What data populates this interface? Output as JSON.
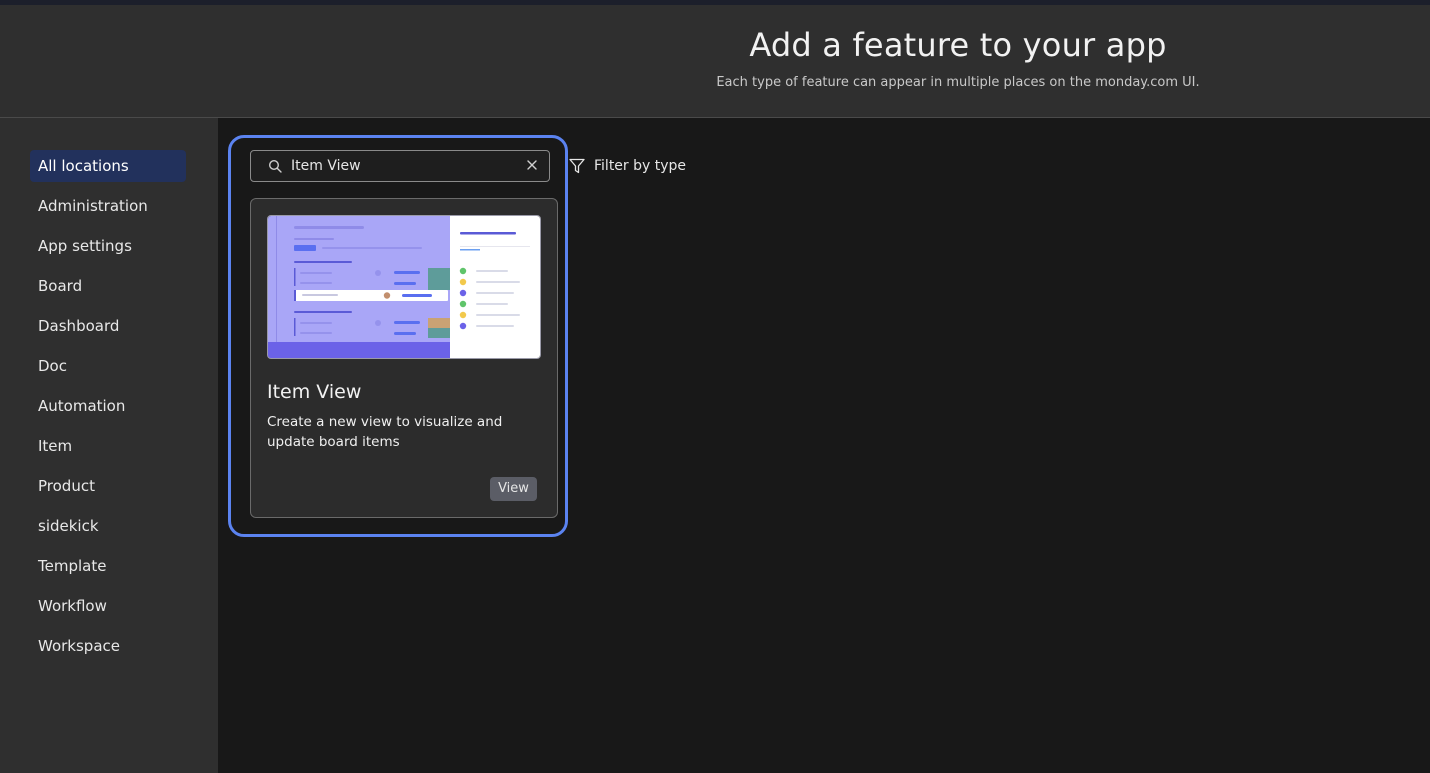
{
  "header": {
    "title": "Add a feature to your app",
    "subtitle": "Each type of feature can appear in multiple places on the monday.com UI."
  },
  "sidebar": {
    "items": [
      {
        "label": "All locations",
        "active": true
      },
      {
        "label": "Administration"
      },
      {
        "label": "App settings"
      },
      {
        "label": "Board"
      },
      {
        "label": "Dashboard"
      },
      {
        "label": "Doc"
      },
      {
        "label": "Automation"
      },
      {
        "label": "Item"
      },
      {
        "label": "Product"
      },
      {
        "label": "sidekick"
      },
      {
        "label": "Template"
      },
      {
        "label": "Workflow"
      },
      {
        "label": "Workspace"
      }
    ]
  },
  "search": {
    "value": "Item View",
    "icon": "search-icon",
    "clear_icon": "close-icon"
  },
  "filter": {
    "label": "Filter by type",
    "icon": "funnel-icon"
  },
  "card": {
    "title": "Item View",
    "description": "Create a new view to visualize and update board items",
    "button_label": "View"
  },
  "colors": {
    "accent": "#5b83f0",
    "active_nav": "#22315c",
    "header_bg": "#2f2f2f",
    "main_bg": "#181818"
  }
}
